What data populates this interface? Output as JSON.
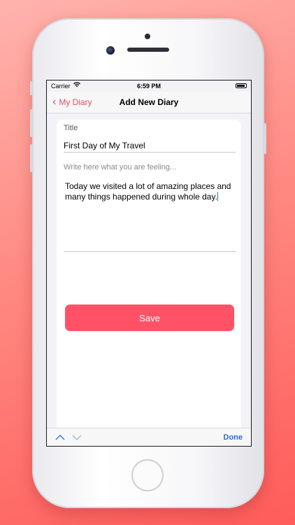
{
  "status_bar": {
    "carrier": "Carrier",
    "time": "6:59 PM"
  },
  "nav": {
    "back_label": "My Diary",
    "title": "Add New Diary"
  },
  "form": {
    "title_label": "Title",
    "title_value": "First Day of My Travel",
    "body_placeholder": "Write here what you are feeling...",
    "body_value": "Today we visited a lot of amazing places and many things happened during whole day."
  },
  "save_button": {
    "label": "Save",
    "color": "#ff5266"
  },
  "keyboard_bar": {
    "done_label": "Done"
  },
  "colors": {
    "accent": "#e0515f",
    "tint_blue": "#2f6bd6"
  }
}
